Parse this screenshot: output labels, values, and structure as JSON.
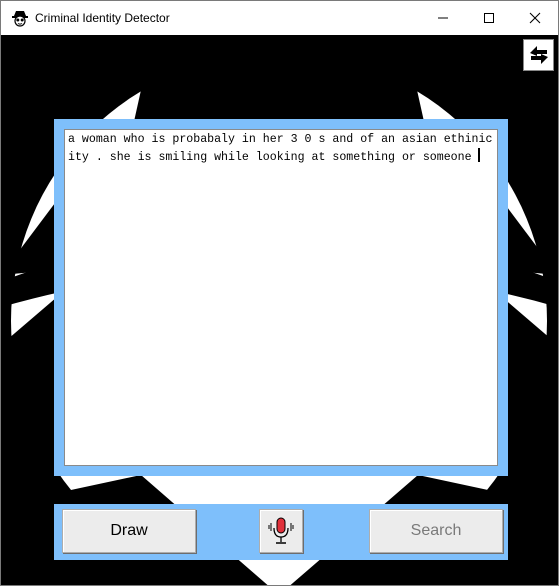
{
  "window": {
    "title": "Criminal Identity Detector",
    "icon": "spy-icon",
    "controls": [
      "minimize-icon",
      "maximize-icon",
      "close-icon"
    ]
  },
  "toolbar": {
    "swap_icon": "swap-arrows-icon"
  },
  "description": {
    "text": "a woman who is probabaly in her 3 0 s and of an asian ethinicity . she is smiling while looking at something or someone"
  },
  "actions": {
    "draw_label": "Draw",
    "search_label": "Search",
    "mic_icon": "microphone-icon"
  },
  "colors": {
    "frame": "#7ebffb",
    "background": "#000000",
    "button_face": "#ececec",
    "search_disabled_text": "#7a7a7a",
    "mic_red": "#e0303a"
  }
}
